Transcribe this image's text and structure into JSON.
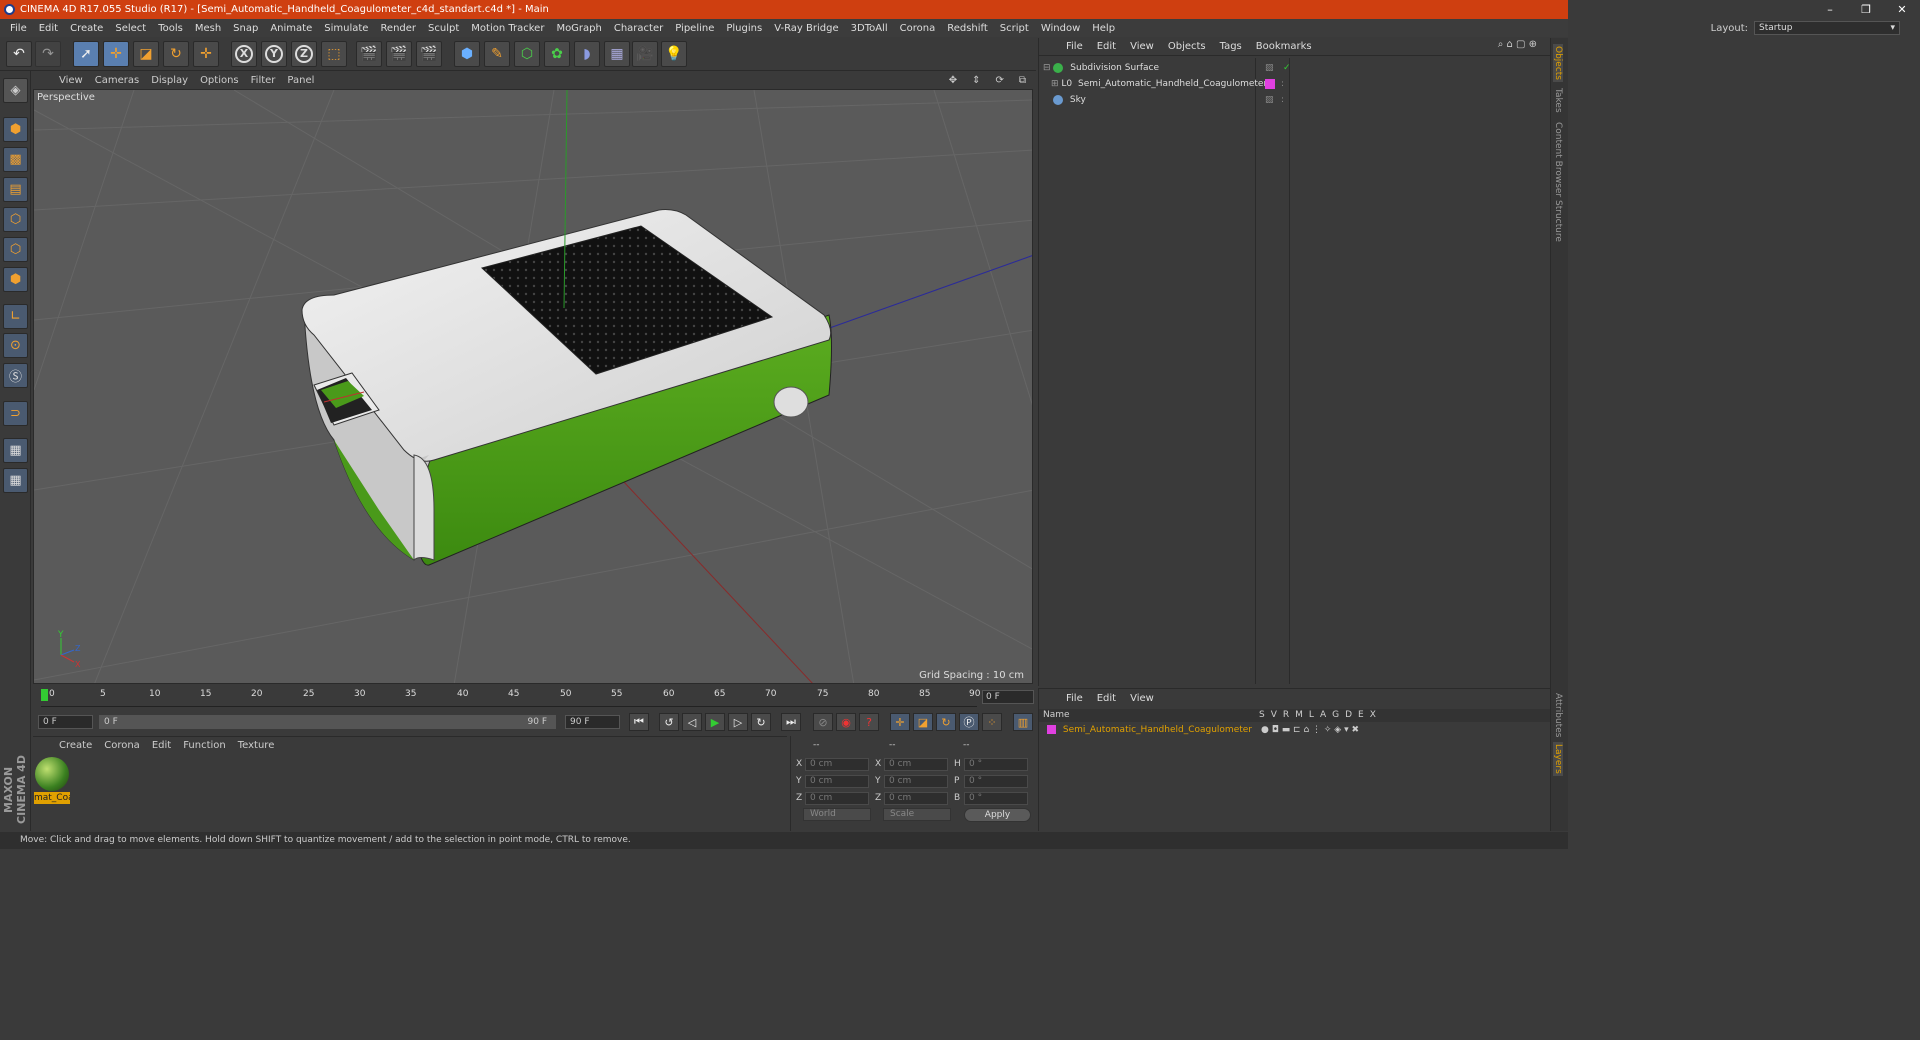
{
  "window": {
    "title": "CINEMA 4D R17.055 Studio (R17) - [Semi_Automatic_Handheld_Coagulometer_c4d_standart.c4d *] - Main",
    "controls": [
      "–",
      "❐",
      "✕"
    ]
  },
  "menubar": {
    "items": [
      "File",
      "Edit",
      "Create",
      "Select",
      "Tools",
      "Mesh",
      "Snap",
      "Animate",
      "Simulate",
      "Render",
      "Sculpt",
      "Motion Tracker",
      "MoGraph",
      "Character",
      "Pipeline",
      "Plugins",
      "V-Ray Bridge",
      "3DToAll",
      "Corona",
      "Redshift",
      "Script",
      "Window",
      "Help"
    ],
    "layout_label": "Layout:",
    "layout_value": "Startup"
  },
  "toolbar": {
    "axis_x": "X",
    "axis_y": "Y",
    "axis_z": "Z"
  },
  "viewport": {
    "menu": [
      "View",
      "Cameras",
      "Display",
      "Options",
      "Filter",
      "Panel"
    ],
    "label": "Perspective",
    "grid_spacing": "Grid Spacing : 10 cm",
    "axis_y": "Y",
    "axis_z": "Z",
    "axis_x": "X"
  },
  "timeline": {
    "ticks": [
      "0",
      "5",
      "10",
      "15",
      "20",
      "25",
      "30",
      "35",
      "40",
      "45",
      "50",
      "55",
      "60",
      "65",
      "70",
      "75",
      "80",
      "85",
      "90"
    ],
    "current_frame": "0 F",
    "start_field": "0 F",
    "range_start": "0 F",
    "range_end": "90 F",
    "end_field": "90 F"
  },
  "material_panel": {
    "menu": [
      "Create",
      "Corona",
      "Edit",
      "Function",
      "Texture"
    ],
    "material_name": "mat_Coa"
  },
  "coord_panel": {
    "header": [
      "--",
      "--",
      "--"
    ],
    "rows": [
      {
        "a": "X",
        "av": "0 cm",
        "b": "X",
        "bv": "0 cm",
        "c": "H",
        "cv": "0 °"
      },
      {
        "a": "Y",
        "av": "0 cm",
        "b": "Y",
        "bv": "0 cm",
        "c": "P",
        "cv": "0 °"
      },
      {
        "a": "Z",
        "av": "0 cm",
        "b": "Z",
        "bv": "0 cm",
        "c": "B",
        "cv": "0 °"
      }
    ],
    "world": "World",
    "scale": "Scale",
    "apply": "Apply"
  },
  "object_manager": {
    "menu": [
      "File",
      "Edit",
      "View",
      "Objects",
      "Tags",
      "Bookmarks"
    ],
    "objects": [
      {
        "name": "Subdivision Surface",
        "icon_color": "#3ab04a"
      },
      {
        "name": "Semi_Automatic_Handheld_Coagulometer",
        "icon_color": "#aaaaaa",
        "tag_color": "#e040e0"
      },
      {
        "name": "Sky",
        "icon_color": "#6a9ad0"
      }
    ]
  },
  "layer_manager": {
    "menu": [
      "File",
      "Edit",
      "View"
    ],
    "name_header": "Name",
    "columns": [
      "S",
      "V",
      "R",
      "M",
      "L",
      "A",
      "G",
      "D",
      "E",
      "X"
    ],
    "layer_name": "Semi_Automatic_Handheld_Coagulometer"
  },
  "right_tabs": [
    "Objects",
    "Takes",
    "Content Browser",
    "Structure",
    "Attributes",
    "Layers"
  ],
  "status": "Move: Click and drag to move elements. Hold down SHIFT to quantize movement / add to the selection in point mode, CTRL to remove.",
  "brand": "MAXON CINEMA 4D",
  "colors": {
    "accent": "#cf3f10",
    "selected": "#e0a000",
    "green": "#4a9a1a"
  }
}
